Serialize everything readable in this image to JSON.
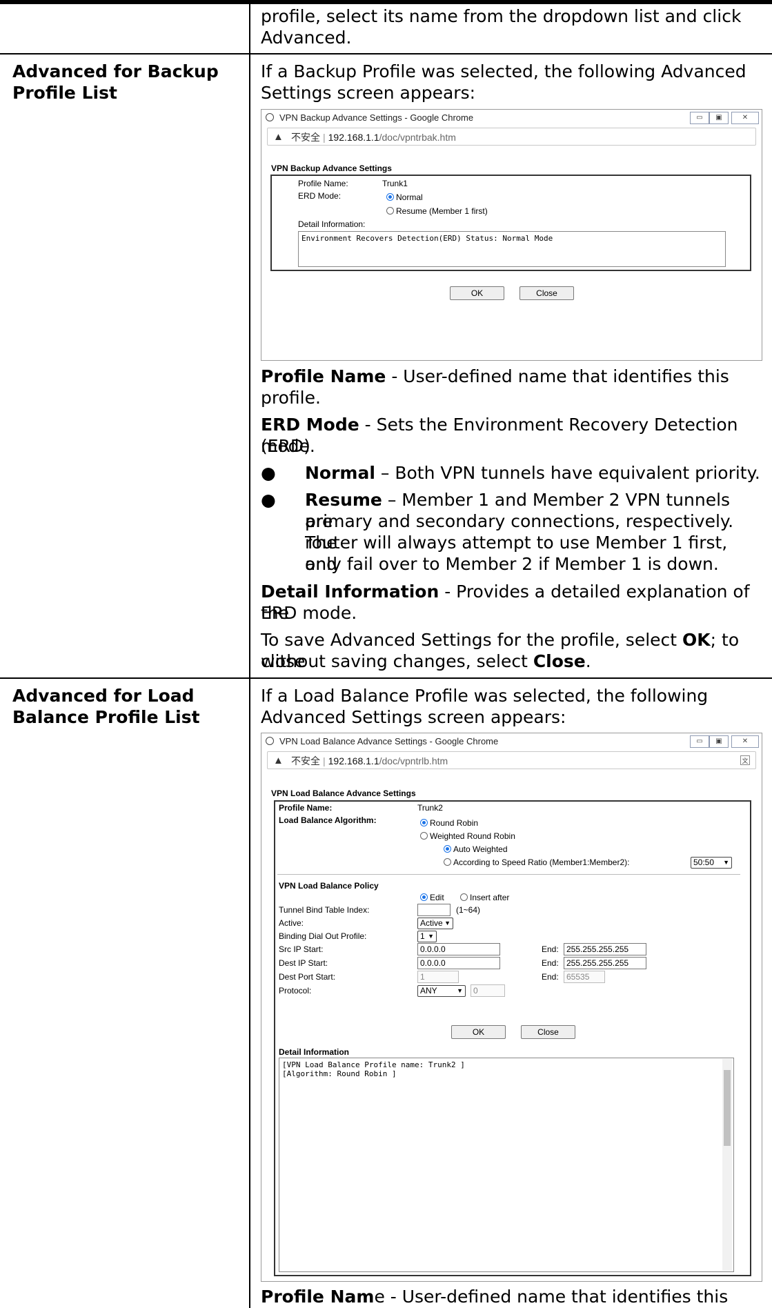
{
  "intro_line1": "profile, select its name from the dropdown list and click",
  "intro_line2": "Advanced.",
  "backup": {
    "label_line1": "Advanced for Backup",
    "label_line2": "Profile List",
    "intro_line1": "If a Backup Profile was selected, the following Advanced",
    "intro_line2": "Settings screen appears:",
    "window": {
      "title": "VPN Backup Advance Settings - Google Chrome",
      "insecure": "不安全",
      "host": "192.168.1.1",
      "path": "/doc/vpntrbak.htm",
      "heading": "VPN Backup Advance Settings",
      "profile_name_label": "Profile Name:",
      "profile_name_value": "Trunk1",
      "erd_mode_label": "ERD Mode:",
      "erd_normal": "Normal",
      "erd_resume": "Resume (Member 1 first)",
      "detail_label": "Detail Information:",
      "detail_text": "Environment Recovers Detection(ERD) Status: Normal Mode",
      "ok": "OK",
      "close": "Close"
    },
    "p1_bold": "Profile Name",
    "p1_rest": " - User-defined name that identifies this",
    "p1_line2": "profile.",
    "p2_bold": "ERD Mode",
    "p2_rest": " - Sets the Environment Recovery Detection (ERD)",
    "p2_line2": "mode.",
    "b1_bold": "Normal",
    "b1_rest": " – Both VPN tunnels have equivalent priority.",
    "b2_bold": "Resume",
    "b2_rest": " – Member 1 and Member 2 VPN tunnels are",
    "b2_line2": "primary and secondary connections, respectively. The",
    "b2_line3": "router will always attempt to use Member 1 first, and",
    "b2_line4": "only fail over to Member 2 if Member 1 is down.",
    "p3_bold": "Detail Information",
    "p3_rest": " - Provides a detailed explanation of the",
    "p3_line2": "ERD mode.",
    "p4_a": "To save Advanced Settings for the profile, select ",
    "p4_ok": "OK",
    "p4_b": "; to close",
    "p4_c": "without saving changes, select ",
    "p4_close": "Close",
    "p4_d": "."
  },
  "loadbal": {
    "label_line1": "Advanced for Load",
    "label_line2": "Balance Profile List",
    "intro_line1": "If a Load Balance Profile was selected, the following",
    "intro_line2": "Advanced Settings screen appears:",
    "window": {
      "title": "VPN Load Balance Advance Settings - Google Chrome",
      "insecure": "不安全",
      "host": "192.168.1.1",
      "path": "/doc/vpntrlb.htm",
      "heading": "VPN Load Balance Advance Settings",
      "profile_name_label": "Profile Name:",
      "profile_name_value": "Trunk2",
      "algo_label": "Load Balance Algorithm:",
      "algo_rr": "Round Robin",
      "algo_wrr": "Weighted Round Robin",
      "auto_weighted": "Auto Weighted",
      "speed_ratio": "According to Speed Ratio (Member1:Member2):",
      "ratio_value": "50:50",
      "policy_heading": "VPN Load Balance Policy",
      "edit": "Edit",
      "insert_after": "Insert after",
      "tunnel_index_label": "Tunnel Bind Table Index:",
      "tunnel_index_hint": "(1~64)",
      "active_label": "Active:",
      "active_value": "Active",
      "binding_label": "Binding Dial Out Profile:",
      "binding_value": "1",
      "src_ip_label": "Src IP Start:",
      "src_ip_value": "0.0.0.0",
      "dest_ip_label": "Dest IP Start:",
      "dest_ip_value": "0.0.0.0",
      "dest_port_label": "Dest Port Start:",
      "dest_port_value": "1",
      "protocol_label": "Protocol:",
      "protocol_value": "ANY",
      "protocol_num": "0",
      "end_label": "End:",
      "src_end_value": "255.255.255.255",
      "dest_end_value": "255.255.255.255",
      "port_end_value": "65535",
      "ok": "OK",
      "close": "Close",
      "detail_heading": "Detail Information",
      "detail_line1": "[VPN Load Balance Profile name: Trunk2 ]",
      "detail_line2": "[Algorithm: Round Robin ]"
    },
    "p1_bold": "Profile Nam",
    "p1_rest": "e - User-defined name that identifies this"
  }
}
